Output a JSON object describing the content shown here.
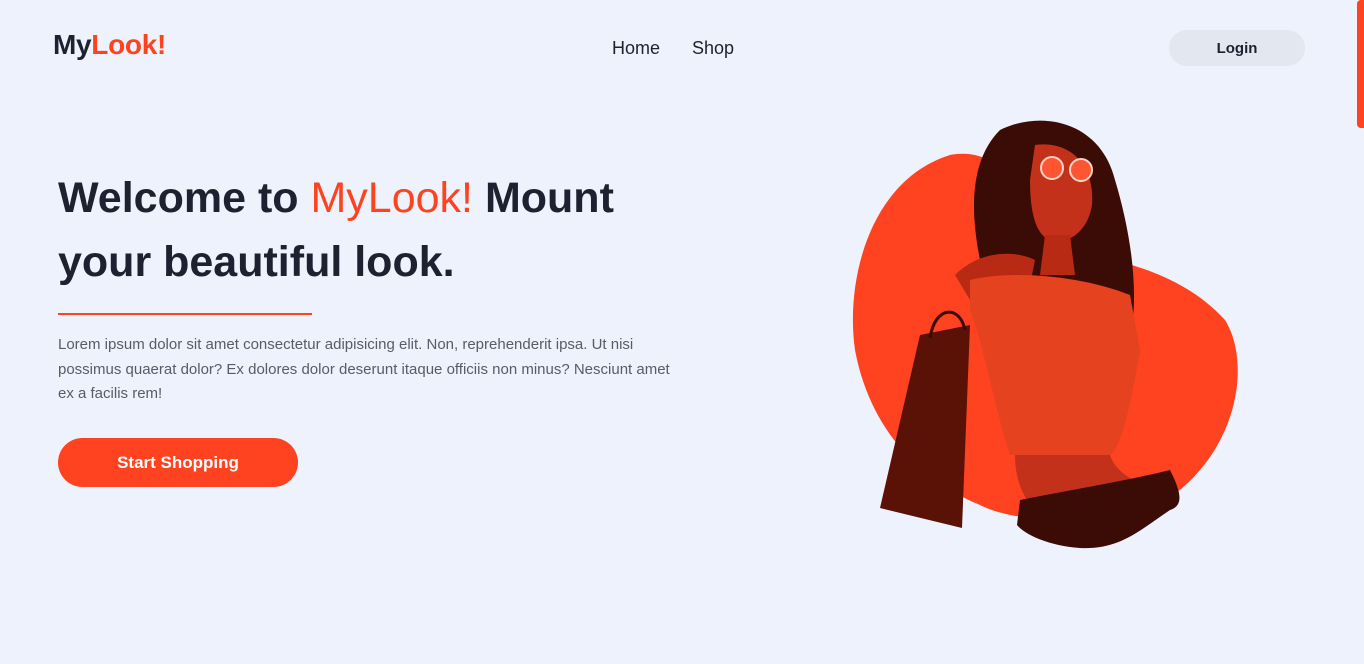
{
  "header": {
    "logo_prefix": "My",
    "logo_accent": "Look!",
    "nav": [
      {
        "label": "Home"
      },
      {
        "label": "Shop"
      }
    ],
    "login_label": "Login"
  },
  "hero": {
    "title_part1": "Welcome to ",
    "title_accent": "MyLook!",
    "title_part2": " Mount your beautiful look.",
    "description": "Lorem ipsum dolor sit amet consectetur adipisicing elit. Non, reprehenderit ipsa. Ut nisi possimus quaerat dolor? Ex dolores dolor deserunt itaque officiis non minus? Nesciunt amet ex a facilis rem!",
    "cta_label": "Start Shopping"
  },
  "colors": {
    "accent": "#ff4320",
    "background": "#eef2fc",
    "text_dark": "#1e2130",
    "text_muted": "#585c68",
    "login_bg": "#e3e7ef"
  },
  "icons": {
    "hero_image": "woman-with-shopping-bag-illustration"
  }
}
